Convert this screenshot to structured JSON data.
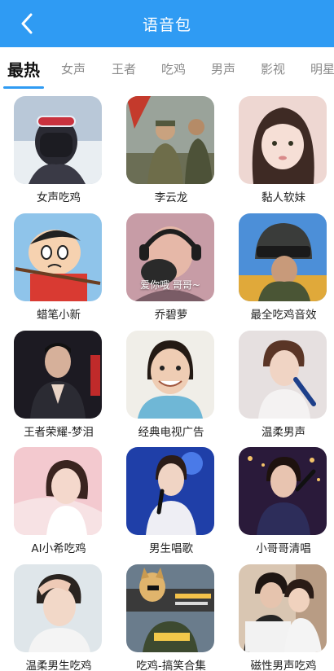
{
  "header": {
    "title": "语音包"
  },
  "tabs": [
    "最热",
    "女声",
    "王者",
    "吃鸡",
    "男声",
    "影视",
    "明星"
  ],
  "items": [
    {
      "name": "女声吃鸡",
      "icon": "girl-goggles-photo"
    },
    {
      "name": "李云龙",
      "icon": "soldiers-photo"
    },
    {
      "name": "黏人软妹",
      "icon": "cute-girl-photo"
    },
    {
      "name": "蜡笔小新",
      "icon": "crayon-shinchan-photo"
    },
    {
      "name": "乔碧萝",
      "icon": "woman-headset-photo",
      "overlay": "爱你哦 哥哥~"
    },
    {
      "name": "最全吃鸡音效",
      "icon": "pubg-helmet-photo"
    },
    {
      "name": "王者荣耀-梦泪",
      "icon": "man-praying-photo"
    },
    {
      "name": "经典电视广告",
      "icon": "child-photo"
    },
    {
      "name": "温柔男声",
      "icon": "singer-mic-photo"
    },
    {
      "name": "AI小希吃鸡",
      "icon": "girl-pink-photo"
    },
    {
      "name": "男生唱歌",
      "icon": "boy-singing-photo"
    },
    {
      "name": "小哥哥清唱",
      "icon": "stage-singer-photo"
    },
    {
      "name": "温柔男生吃鸡",
      "icon": "boy-hand-hair-photo"
    },
    {
      "name": "吃鸡-搞笑合集",
      "icon": "pubg-doge-photo"
    },
    {
      "name": "磁性男声吃鸡",
      "icon": "couple-photo"
    }
  ],
  "colors": {
    "header": "#2f9bf3",
    "accent": "#2f9bf3"
  }
}
